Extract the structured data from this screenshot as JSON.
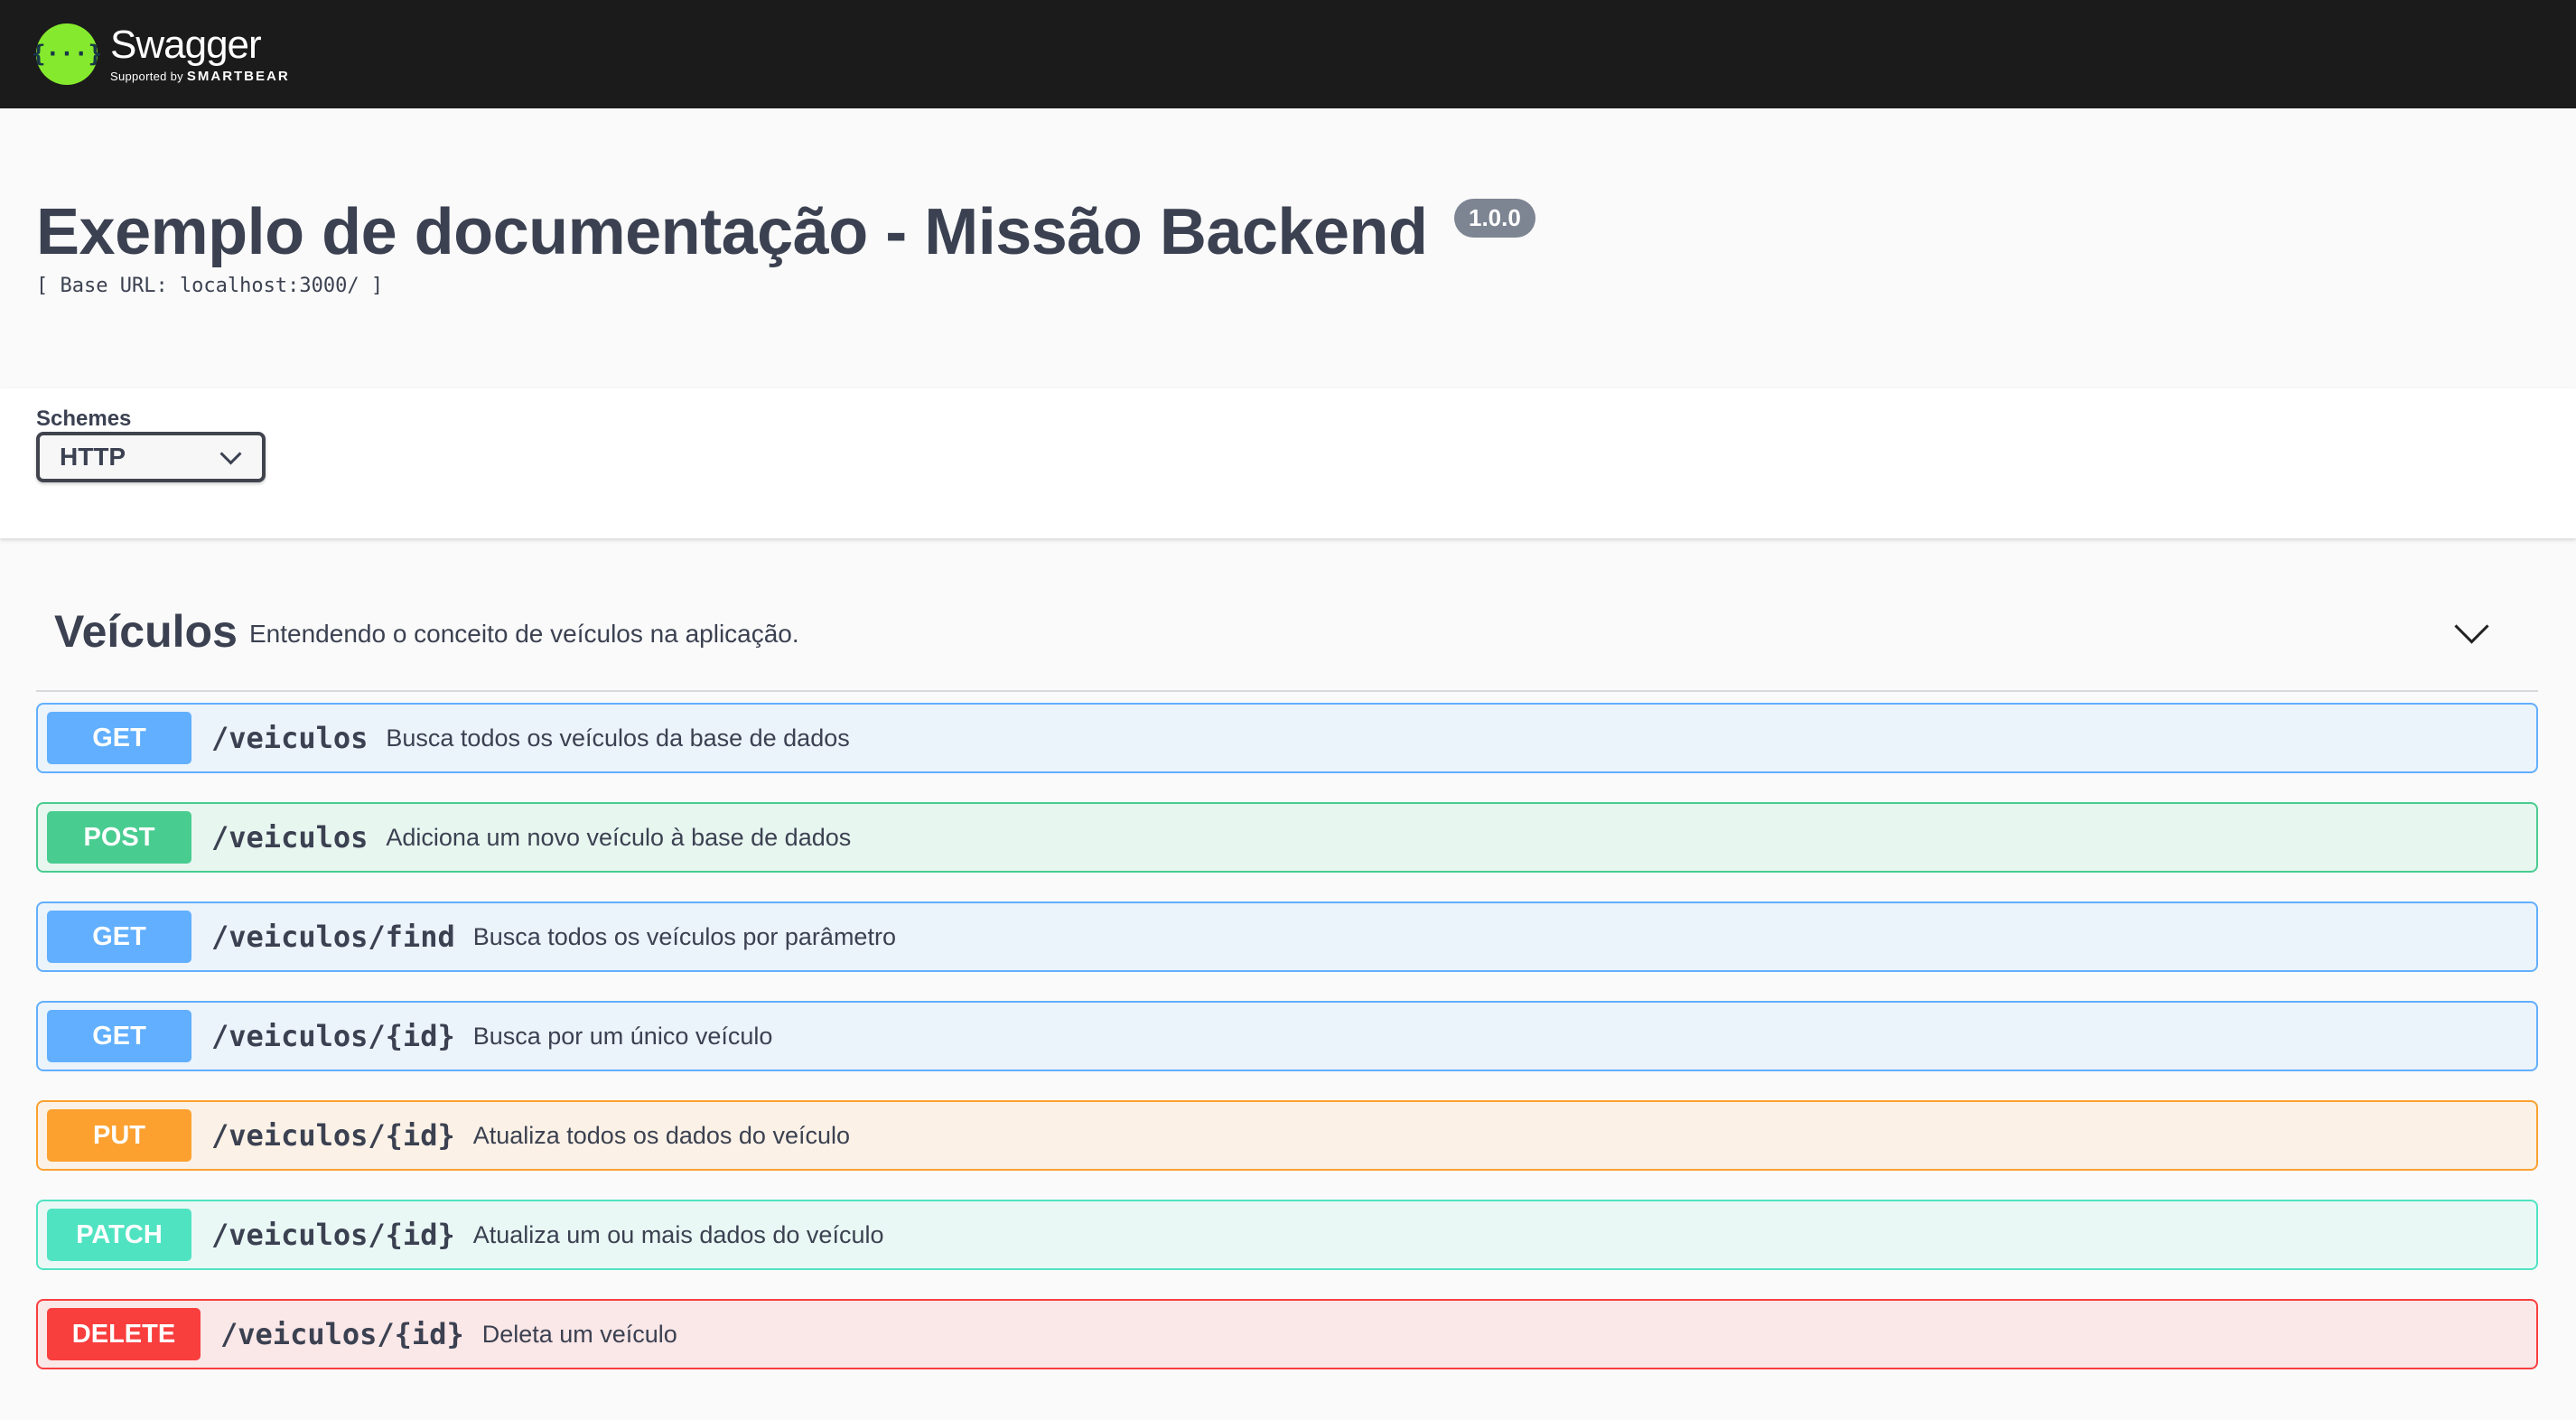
{
  "topbar": {
    "logo_glyph": "{···}",
    "brand": "Swagger",
    "supported_by": "Supported by",
    "company": "SMARTBEAR",
    "bg_color": "#1b1b1b",
    "logo_color": "#85ea2d"
  },
  "info": {
    "title": "Exemplo de documentação - Missão Backend",
    "version": "1.0.0",
    "base_url": "[ Base URL: localhost:3000/ ]"
  },
  "schemes": {
    "label": "Schemes",
    "selected": "HTTP"
  },
  "tag": {
    "name": "Veículos",
    "description": "Entendendo o conceito de veículos na aplicação.",
    "expanded_icon": "chevron-down-icon"
  },
  "operations": [
    {
      "method": "GET",
      "path": "/veiculos",
      "summary": "Busca todos os veículos da base de dados",
      "color": "#61affe"
    },
    {
      "method": "POST",
      "path": "/veiculos",
      "summary": "Adiciona um novo veículo à base de dados",
      "color": "#49cc90"
    },
    {
      "method": "GET",
      "path": "/veiculos/find",
      "summary": "Busca todos os veículos por parâmetro",
      "color": "#61affe"
    },
    {
      "method": "GET",
      "path": "/veiculos/{id}",
      "summary": "Busca por um único veículo",
      "color": "#61affe"
    },
    {
      "method": "PUT",
      "path": "/veiculos/{id}",
      "summary": "Atualiza todos os dados do veículo",
      "color": "#fca130"
    },
    {
      "method": "PATCH",
      "path": "/veiculos/{id}",
      "summary": "Atualiza um ou mais dados do veículo",
      "color": "#50e3c2"
    },
    {
      "method": "DELETE",
      "path": "/veiculos/{id}",
      "summary": "Deleta um veículo",
      "color": "#f93e3e"
    }
  ]
}
